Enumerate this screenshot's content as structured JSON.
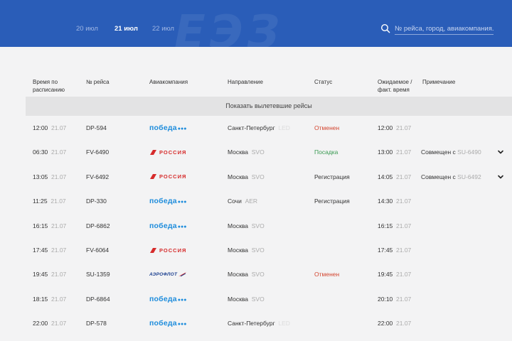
{
  "header": {
    "watermark": "ЕЭЗ",
    "dates": [
      "20 июл",
      "21 июл",
      "22 июл"
    ],
    "active_date": "21 июл",
    "search_placeholder": "№ рейса, город, авиакомпания..."
  },
  "columns": {
    "scheduled": "Время по расписанию",
    "flight": "№ рейса",
    "airline": "Авиакомпания",
    "destination": "Направление",
    "status": "Статус",
    "actual": "Ожидаемое / факт. время",
    "note": "Примечание"
  },
  "show_departed_label": "Показать вылетевшие рейсы",
  "flights": [
    {
      "time": "12:00",
      "date": "21.07",
      "flight": "DP-594",
      "airline": "победа",
      "dest": "Санкт-Петербург",
      "code": "LED",
      "status": "Отменен",
      "status_type": "cancelled",
      "act_time": "12:00",
      "act_date": "21.07",
      "note_prefix": "",
      "note_code": ""
    },
    {
      "time": "06:30",
      "date": "21.07",
      "flight": "FV-6490",
      "airline": "РОССИЯ",
      "dest": "Москва",
      "code": "SVO",
      "status": "Посадка",
      "status_type": "boarding",
      "act_time": "13:00",
      "act_date": "21.07",
      "note_prefix": "Совмещен с ",
      "note_code": "SU-6490"
    },
    {
      "time": "13:05",
      "date": "21.07",
      "flight": "FV-6492",
      "airline": "РОССИЯ",
      "dest": "Москва",
      "code": "SVO",
      "status": "Регистрация",
      "status_type": "normal",
      "act_time": "14:05",
      "act_date": "21.07",
      "note_prefix": "Совмещен с ",
      "note_code": "SU-6492"
    },
    {
      "time": "11:25",
      "date": "21.07",
      "flight": "DP-330",
      "airline": "победа",
      "dest": "Сочи",
      "code": "AER",
      "status": "Регистрация",
      "status_type": "normal",
      "act_time": "14:30",
      "act_date": "21.07",
      "note_prefix": "",
      "note_code": ""
    },
    {
      "time": "16:15",
      "date": "21.07",
      "flight": "DP-6862",
      "airline": "победа",
      "dest": "Москва",
      "code": "SVO",
      "status": "",
      "status_type": "normal",
      "act_time": "16:15",
      "act_date": "21.07",
      "note_prefix": "",
      "note_code": ""
    },
    {
      "time": "17:45",
      "date": "21.07",
      "flight": "FV-6064",
      "airline": "РОССИЯ",
      "dest": "Москва",
      "code": "SVO",
      "status": "",
      "status_type": "normal",
      "act_time": "17:45",
      "act_date": "21.07",
      "note_prefix": "",
      "note_code": ""
    },
    {
      "time": "19:45",
      "date": "21.07",
      "flight": "SU-1359",
      "airline": "АЭРОФЛОТ",
      "dest": "Москва",
      "code": "SVO",
      "status": "Отменен",
      "status_type": "cancelled",
      "act_time": "19:45",
      "act_date": "21.07",
      "note_prefix": "",
      "note_code": ""
    },
    {
      "time": "18:15",
      "date": "21.07",
      "flight": "DP-6864",
      "airline": "победа",
      "dest": "Москва",
      "code": "SVO",
      "status": "",
      "status_type": "normal",
      "act_time": "20:10",
      "act_date": "21.07",
      "note_prefix": "",
      "note_code": ""
    },
    {
      "time": "22:00",
      "date": "21.07",
      "flight": "DP-578",
      "airline": "победа",
      "dest": "Санкт-Петербург",
      "code": "LED",
      "status": "",
      "status_type": "normal",
      "act_time": "22:00",
      "act_date": "21.07",
      "note_prefix": "",
      "note_code": ""
    }
  ],
  "colors": {
    "header_bg": "#2a5db8",
    "pobeda_blue": "#1f8ddc",
    "rossiya_red": "#d62b2b",
    "aeroflot_blue": "#1b3f8f",
    "cancelled": "#d3452f",
    "boarding": "#3a9a52"
  }
}
